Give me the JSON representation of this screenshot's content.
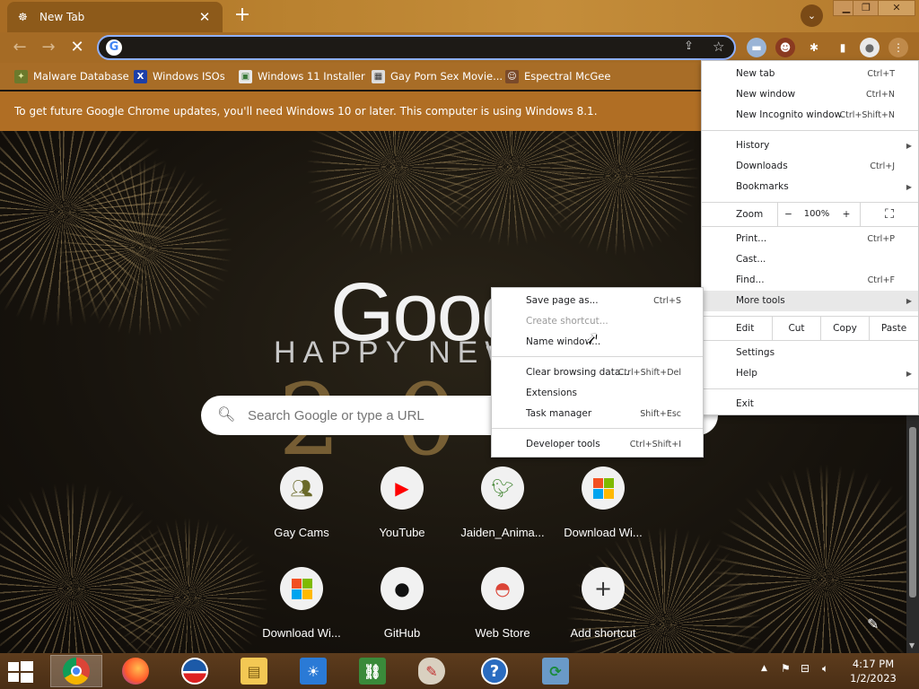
{
  "window": {
    "tab_title": "New Tab",
    "minimize": "▁",
    "restore": "❐",
    "close": "✕"
  },
  "toolbar": {
    "omnibox_value": ""
  },
  "bookmarks": [
    {
      "label": "Malware Database",
      "icon": "alien-icon"
    },
    {
      "label": "Windows ISOs",
      "icon": "x-icon"
    },
    {
      "label": "Windows 11 Installer",
      "icon": "image-icon"
    },
    {
      "label": "Gay Porn Sex Movie...",
      "icon": "film-icon"
    },
    {
      "label": "Espectral McGee",
      "icon": "character-icon"
    }
  ],
  "infobar": {
    "message": "To get future Google Chrome updates, you'll need Windows 10 or later. This computer is using Windows 8.1."
  },
  "ntp": {
    "logo": "Goog",
    "happy": "HAPPY NEW",
    "year": "2023",
    "search_placeholder": "Search Google or type a URL",
    "tiles": [
      {
        "label": "Gay Cams",
        "icon": "people-icon"
      },
      {
        "label": "YouTube",
        "icon": "youtube-icon"
      },
      {
        "label": "Jaiden_Anima...",
        "icon": "bird-icon"
      },
      {
        "label": "Download Wi...",
        "icon": "windows-logo-icon"
      },
      {
        "label": "Download Wi...",
        "icon": "windows-logo-icon"
      },
      {
        "label": "GitHub",
        "icon": "github-icon"
      },
      {
        "label": "Web Store",
        "icon": "chrome-webstore-icon"
      },
      {
        "label": "Add shortcut",
        "icon": "plus-icon"
      }
    ]
  },
  "menu": {
    "new_tab": {
      "label": "New tab",
      "shortcut": "Ctrl+T"
    },
    "new_window": {
      "label": "New window",
      "shortcut": "Ctrl+N"
    },
    "new_incognito": {
      "label": "New Incognito window",
      "shortcut": "Ctrl+Shift+N"
    },
    "history": {
      "label": "History"
    },
    "downloads": {
      "label": "Downloads",
      "shortcut": "Ctrl+J"
    },
    "bookmarks": {
      "label": "Bookmarks"
    },
    "zoom": {
      "label": "Zoom",
      "minus": "−",
      "value": "100%",
      "plus": "+"
    },
    "print": {
      "label": "Print...",
      "shortcut": "Ctrl+P"
    },
    "cast": {
      "label": "Cast..."
    },
    "find": {
      "label": "Find...",
      "shortcut": "Ctrl+F"
    },
    "more_tools": {
      "label": "More tools"
    },
    "edit": {
      "label": "Edit",
      "cut": "Cut",
      "copy": "Copy",
      "paste": "Paste"
    },
    "settings": {
      "label": "Settings"
    },
    "help": {
      "label": "Help"
    },
    "exit": {
      "label": "Exit"
    }
  },
  "submenu": {
    "save_page": {
      "label": "Save page as...",
      "shortcut": "Ctrl+S"
    },
    "create_shortcut": {
      "label": "Create shortcut..."
    },
    "name_window": {
      "label": "Name window..."
    },
    "clear_browsing": {
      "label": "Clear browsing data...",
      "shortcut": "Ctrl+Shift+Del"
    },
    "extensions": {
      "label": "Extensions"
    },
    "task_manager": {
      "label": "Task manager",
      "shortcut": "Shift+Esc"
    },
    "developer_tools": {
      "label": "Developer tools",
      "shortcut": "Ctrl+Shift+I"
    }
  },
  "taskbar": {
    "apps": [
      "chrome-icon",
      "firefox-icon",
      "obama-logo-icon",
      "file-explorer-icon",
      "weather-icon",
      "network-people-icon",
      "paint-icon",
      "help-icon",
      "computer-refresh-icon"
    ],
    "help_glyph": "?",
    "time": "4:17 PM",
    "date": "1/2/2023"
  }
}
